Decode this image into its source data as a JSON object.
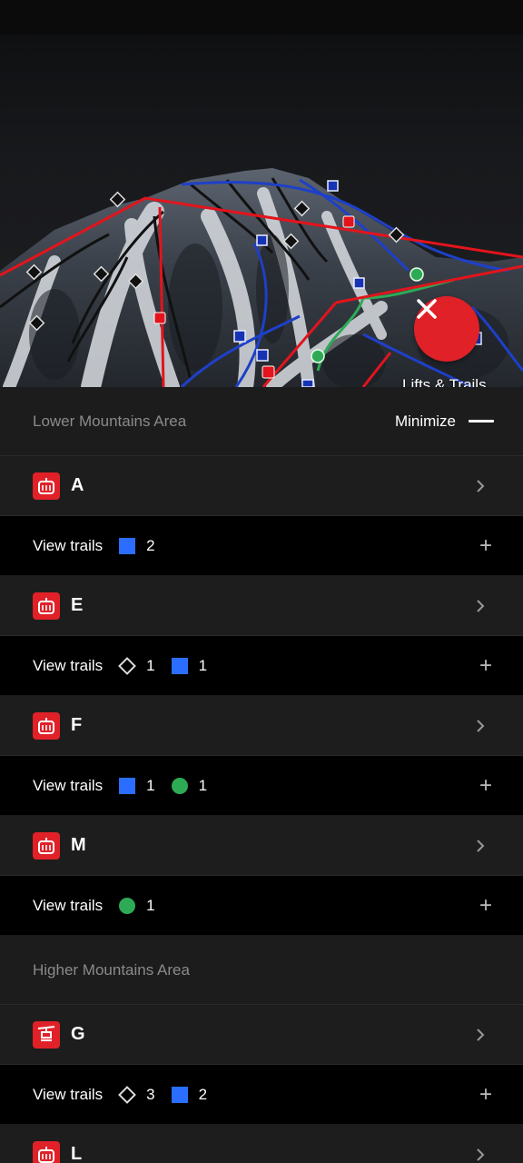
{
  "map": {
    "caption": "Lifts & Trails",
    "close_icon": "close-icon"
  },
  "sections": [
    {
      "title": "Lower Mountains Area",
      "minimize_label": "Minimize",
      "lifts": [
        {
          "name": "A",
          "icon": "gondola-icon",
          "trails": [
            {
              "kind": "blue-square",
              "count": "2"
            }
          ]
        },
        {
          "name": "E",
          "icon": "gondola-icon",
          "trails": [
            {
              "kind": "black-diamond",
              "count": "1"
            },
            {
              "kind": "blue-square",
              "count": "1"
            }
          ]
        },
        {
          "name": "F",
          "icon": "gondola-icon",
          "trails": [
            {
              "kind": "blue-square",
              "count": "1"
            },
            {
              "kind": "green-circle",
              "count": "1"
            }
          ]
        },
        {
          "name": "M",
          "icon": "gondola-icon",
          "trails": [
            {
              "kind": "green-circle",
              "count": "1"
            }
          ]
        }
      ]
    },
    {
      "title": "Higher Mountains Area",
      "lifts": [
        {
          "name": "G",
          "icon": "chairlift-icon",
          "trails": [
            {
              "kind": "black-diamond",
              "count": "3"
            },
            {
              "kind": "blue-square",
              "count": "2"
            }
          ]
        },
        {
          "name": "L",
          "icon": "gondola-icon"
        }
      ]
    }
  ],
  "view_trails_label": "View trails",
  "colors": {
    "accent_red": "#e02128",
    "blue": "#2b6dff",
    "green": "#2eaa56"
  }
}
